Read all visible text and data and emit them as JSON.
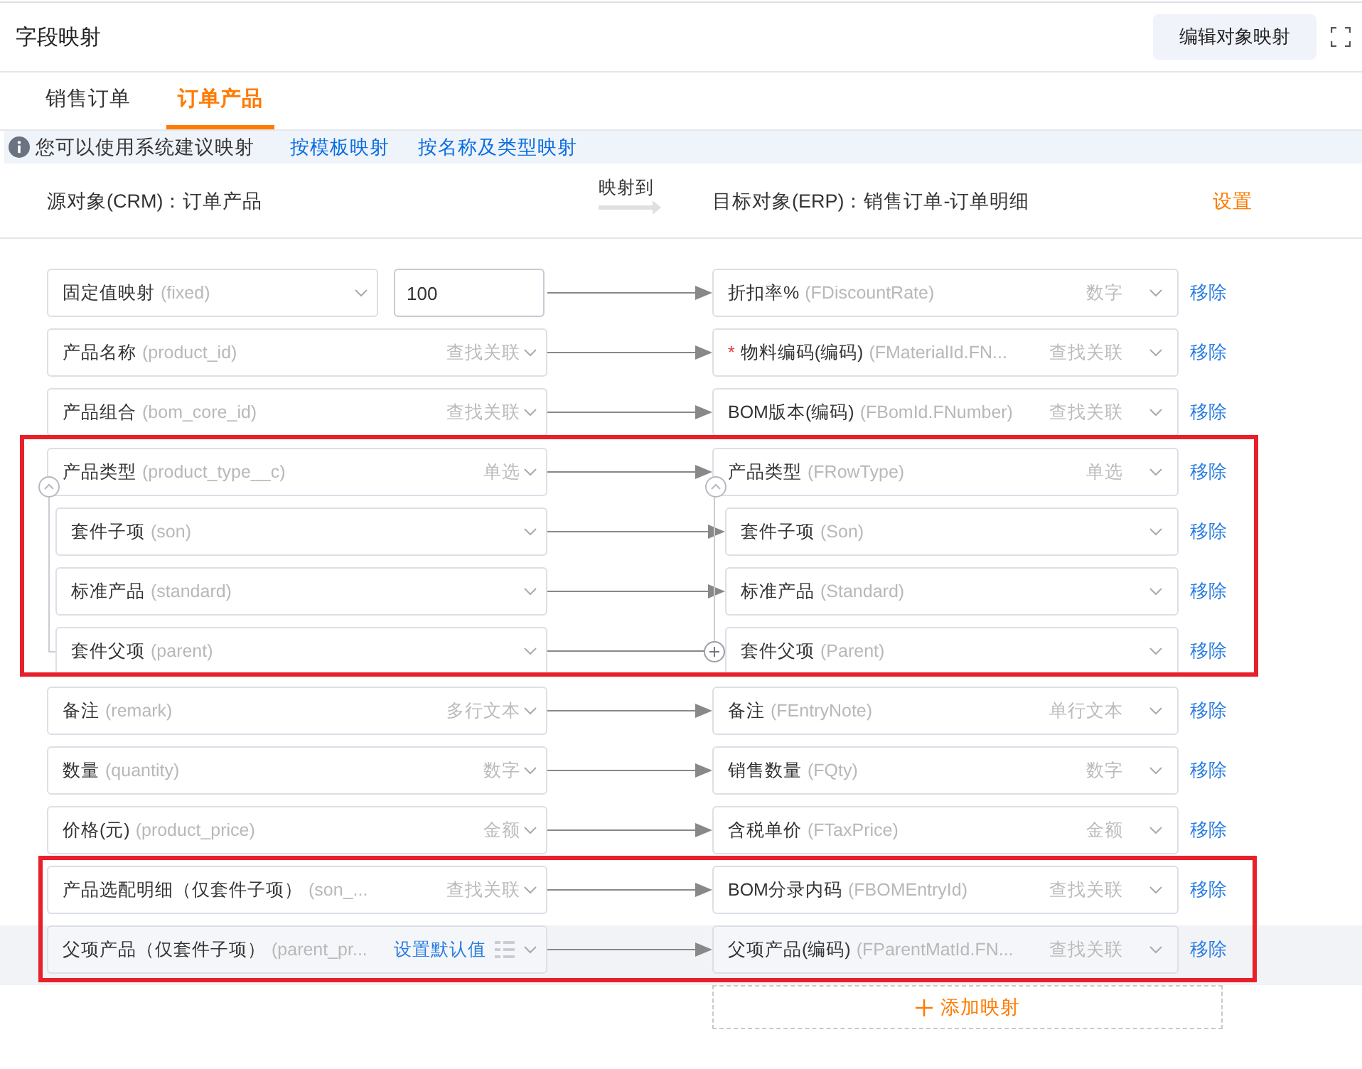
{
  "window": {
    "title": "字段映射",
    "edit_button": "编辑对象映射"
  },
  "tabs": [
    {
      "label": "销售订单",
      "selected": false
    },
    {
      "label": "订单产品",
      "selected": true
    }
  ],
  "hint": {
    "text": "您可以使用系统建议映射",
    "links": [
      "按模板映射",
      "按名称及类型映射"
    ]
  },
  "objects": {
    "source": "源对象(CRM)：订单产品",
    "map_to": "映射到",
    "target": "目标对象(ERP)：销售订单-订单明细",
    "settings": "设置"
  },
  "rows": [
    {
      "kind": "fixed",
      "framed": false,
      "hovered": false,
      "source": {
        "label": "固定值映射",
        "code": "(fixed)"
      },
      "value": "100",
      "target": {
        "label": "折扣率%",
        "code": "(FDiscountRate)",
        "type": "数字"
      },
      "remove": "移除"
    },
    {
      "kind": "field",
      "framed": false,
      "hovered": false,
      "source": {
        "label": "产品名称",
        "code": "(product_id)",
        "type": "查找关联"
      },
      "target": {
        "required_mark": "*",
        "label": "物料编码(编码)",
        "code": "(FMaterialId.FN...",
        "type": "查找关联"
      },
      "remove": "移除"
    },
    {
      "kind": "field",
      "framed": false,
      "hovered": false,
      "source": {
        "label": "产品组合",
        "code": "(bom_core_id)",
        "type": "查找关联"
      },
      "target": {
        "label": "BOM版本(编码)",
        "code": "(FBomId.FNumber)",
        "type": "查找关联"
      },
      "remove": "移除"
    },
    {
      "kind": "group",
      "framed": true,
      "hovered": false,
      "expanded": true,
      "source": {
        "label": "产品类型",
        "code": "(product_type__c)",
        "type": "单选"
      },
      "target": {
        "label": "产品类型",
        "code": "(FRowType)",
        "type": "单选"
      },
      "remove": "移除",
      "children": [
        {
          "source": {
            "label": "套件子项",
            "code": "(son)"
          },
          "target": {
            "label": "套件子项",
            "code": "(Son)"
          },
          "remove": "移除"
        },
        {
          "source": {
            "label": "标准产品",
            "code": "(standard)"
          },
          "target": {
            "label": "标准产品",
            "code": "(Standard)"
          },
          "remove": "移除"
        },
        {
          "source": {
            "label": "套件父项",
            "code": "(parent)"
          },
          "target": {
            "label": "套件父项",
            "code": "(Parent)"
          },
          "remove": "移除"
        }
      ]
    },
    {
      "kind": "field",
      "framed": false,
      "hovered": false,
      "source": {
        "label": "备注",
        "code": "(remark)",
        "type": "多行文本"
      },
      "target": {
        "label": "备注",
        "code": "(FEntryNote)",
        "type": "单行文本"
      },
      "remove": "移除"
    },
    {
      "kind": "field",
      "framed": false,
      "hovered": false,
      "source": {
        "label": "数量",
        "code": "(quantity)",
        "type": "数字"
      },
      "target": {
        "label": "销售数量",
        "code": "(FQty)",
        "type": "数字"
      },
      "remove": "移除"
    },
    {
      "kind": "field",
      "framed": false,
      "hovered": false,
      "source": {
        "label": "价格(元)",
        "code": "(product_price)",
        "type": "金额"
      },
      "target": {
        "label": "含税单价",
        "code": "(FTaxPrice)",
        "type": "金额"
      },
      "remove": "移除"
    },
    {
      "kind": "field",
      "framed": true,
      "hovered": false,
      "source": {
        "label": "产品选配明细（仅套件子项）",
        "code": "(son_...",
        "type": "查找关联"
      },
      "target": {
        "label": "BOM分录内码",
        "code": "(FBOMEntryId)",
        "type": "查找关联"
      },
      "remove": "移除"
    },
    {
      "kind": "field",
      "framed": true,
      "hovered": true,
      "source": {
        "label": "父项产品（仅套件子项）",
        "code": "(parent_pr...",
        "default_link": "设置默认值"
      },
      "target": {
        "label": "父项产品(编码)",
        "code": "(FParentMatId.FN...",
        "type": "查找关联"
      },
      "remove": "移除"
    }
  ],
  "add_button": "添加映射"
}
